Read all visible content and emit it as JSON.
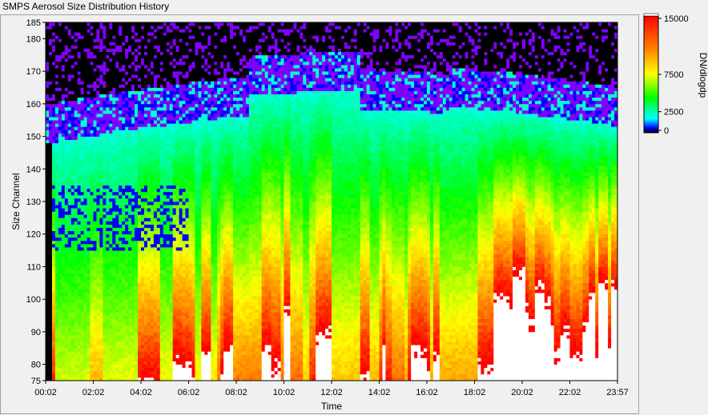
{
  "window_title": "SMPS Aerosol Size Distribution History",
  "chart_data": {
    "type": "heatmap",
    "title": "SMPS Aerosol Size Distribution History",
    "xlabel": "Time",
    "ylabel": "Size Channel",
    "x_ticks": [
      "00:02",
      "02:02",
      "04:02",
      "06:02",
      "08:02",
      "10:02",
      "12:02",
      "14:02",
      "16:02",
      "18:02",
      "20:02",
      "22:02",
      "23:57"
    ],
    "y_ticks": [
      "75",
      "80",
      "90",
      "100",
      "110",
      "120",
      "130",
      "140",
      "150",
      "160",
      "170",
      "180",
      "185"
    ],
    "ylim": [
      75,
      185
    ],
    "colorbar": {
      "label": "DN/dlogdp",
      "ticks": [
        "15000",
        "7500",
        "2500",
        "0"
      ],
      "range": [
        0,
        15000
      ]
    },
    "colormap": [
      "#000000",
      "#8000ff",
      "#0000ff",
      "#00ffff",
      "#00ff00",
      "#ffff00",
      "#ff8000",
      "#ff0000",
      "#ffffff"
    ],
    "grid": false
  }
}
